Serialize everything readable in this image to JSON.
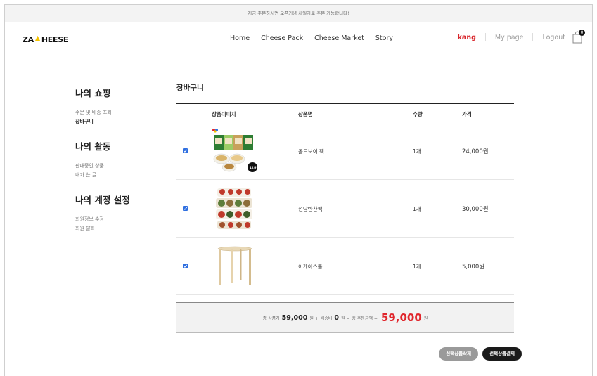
{
  "topbar": {
    "notice": "지금 주문하시면 오픈기념 세일가로 주문 가능합니다!"
  },
  "header": {
    "logo_left": "ZA",
    "logo_right": "HEESE",
    "nav": [
      "Home",
      "Cheese Pack",
      "Cheese Market",
      "Story"
    ],
    "username": "kang",
    "mypage": "My page",
    "logout": "Logout",
    "cart_count": "0"
  },
  "sidebar": {
    "groups": [
      {
        "title": "나의 쇼핑",
        "links": [
          "주문 및 배송 조회",
          "장바구니"
        ]
      },
      {
        "title": "나의 활동",
        "links": [
          "판매중인 상품",
          "내가 쓴 글"
        ]
      },
      {
        "title": "나의 계정 설정",
        "links": [
          "회원정보 수정",
          "회원 탈퇴"
        ]
      }
    ]
  },
  "cart": {
    "title": "장바구니",
    "headers": {
      "image": "상품이미지",
      "name": "상품명",
      "qty": "수량",
      "price": "가격"
    },
    "items": [
      {
        "name": "올드보이 팩",
        "qty": "1개",
        "price": "24,000원",
        "badge": "12개입"
      },
      {
        "name": "현담반찬팩",
        "qty": "1개",
        "price": "30,000원"
      },
      {
        "name": "이케아스툴",
        "qty": "1개",
        "price": "5,000원"
      }
    ],
    "summary": {
      "label_products": "총 상품가",
      "products_total": "59,000",
      "won1": "원 +",
      "label_shipping": "배송비",
      "shipping": "0",
      "won2": "원 =",
      "label_order": "총 주문금액 =",
      "order_total": "59,000",
      "won3": "원"
    },
    "delete_label": "선택상품삭제",
    "checkout_label": "선택상품결제"
  },
  "colors": {
    "accent": "#e0262c",
    "checkbox": "#2f6fe0",
    "dark_button": "#1a1a1a"
  }
}
